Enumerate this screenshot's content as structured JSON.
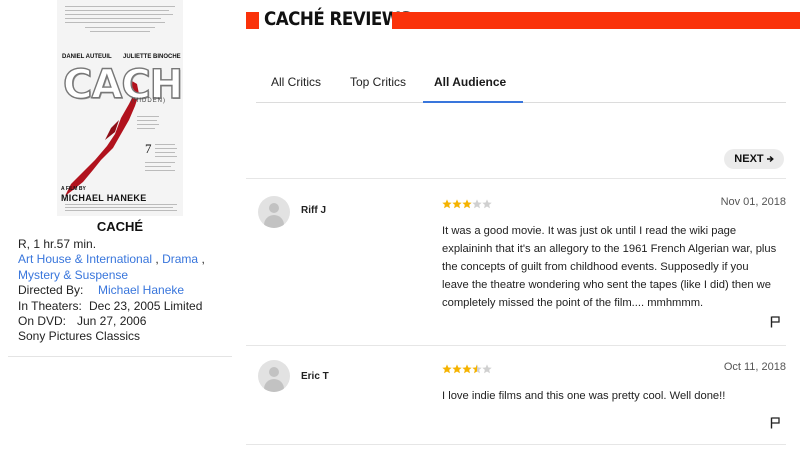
{
  "poster": {
    "actor_left": "DANIEL AUTEUIL",
    "actor_right": "JULIETTE BINOCHE",
    "logo": "CACHÉ",
    "subtitle": "(HIDDEN)",
    "award_number": "7",
    "film_by": "A FILM BY",
    "director": "MICHAEL HANEKE"
  },
  "movie": {
    "title": "CACHÉ",
    "rating_runtime": "R, 1 hr.57 min.",
    "genres": [
      "Art House & International",
      "Drama",
      "Mystery & Suspense"
    ],
    "genre_sep": " ,",
    "directed_label": "Directed By:",
    "director": "Michael Haneke",
    "theaters_label": "In Theaters:",
    "theaters_value": "Dec 23, 2005 Limited",
    "dvd_label": "On DVD:",
    "dvd_value": "Jun 27, 2006",
    "studio": "Sony Pictures Classics"
  },
  "header": {
    "title": "CACHÉ REVIEWS",
    "accent": "#fa320a"
  },
  "tabs": [
    {
      "label": "All Critics",
      "active": false
    },
    {
      "label": "Top Critics",
      "active": false
    },
    {
      "label": "All Audience",
      "active": true
    }
  ],
  "next_label": "NEXT",
  "next_icon": "arrow-right-icon",
  "reviews": [
    {
      "name": "Riff J",
      "rating": 3,
      "date": "Nov 01, 2018",
      "text": "It was a good movie. It was just ok until I read the wiki page explaininh that it's an allegory to the 1961 French Algerian war, plus the concepts of guilt from childhood events. Supposedly if you leave the theatre wondering who sent the tapes (like I did) then we completely missed the point of the film.... mmhmmm."
    },
    {
      "name": "Eric T",
      "rating": 3.5,
      "date": "Oct 11, 2018",
      "text": "I love indie films and this one was pretty cool. Well done!!"
    }
  ],
  "colors": {
    "link": "#3976dc",
    "star": "#f5b301",
    "star_empty": "#d0d0d0"
  }
}
